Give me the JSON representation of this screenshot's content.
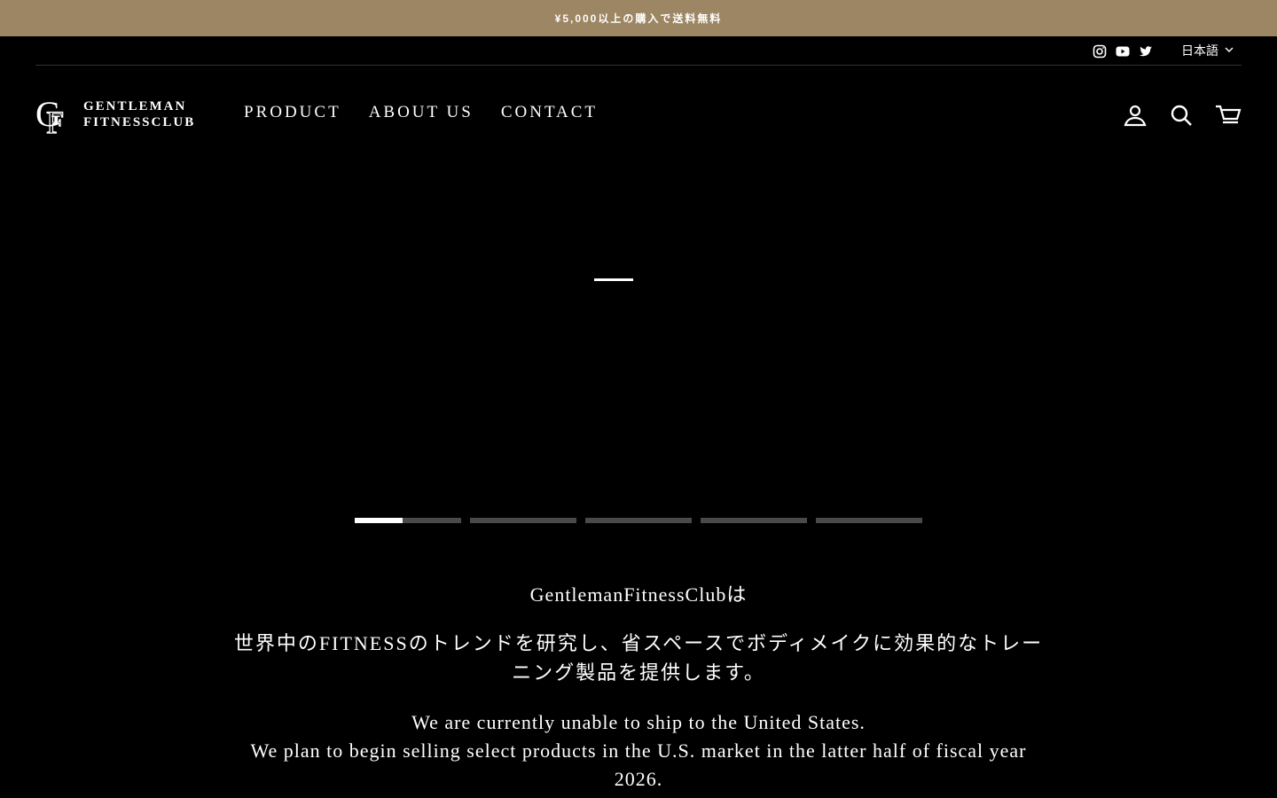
{
  "announcement": "¥5,000以上の購入で送料無料",
  "topbar": {
    "social": [
      {
        "name": "Instagram",
        "icon": "instagram-icon"
      },
      {
        "name": "YouTube",
        "icon": "youtube-icon"
      },
      {
        "name": "Twitter",
        "icon": "twitter-icon"
      }
    ],
    "language": "日本語"
  },
  "logo": {
    "line1": "GENTLEMAN",
    "line2": "FITNESSCLUB"
  },
  "nav": {
    "product": "PRODUCT",
    "about": "ABOUT US",
    "contact": "CONTACT"
  },
  "header_icons": [
    "user-icon",
    "search-icon",
    "cart-icon"
  ],
  "slideshow": {
    "count": 5,
    "active_index": 0,
    "active_progress": 0.45
  },
  "content": {
    "line1": "GentlemanFitnessClubは",
    "line2": "世界中のFITNESSのトレンドを研究し、省スペースでボディメイクに効果的なトレーニング製品を提供します。",
    "line3": "We are currently unable to ship to the United States.",
    "line4": "We plan to begin selling select products in the U.S. market in the latter half of fiscal year 2026."
  },
  "colors": {
    "announcement_bg": "#9c8663",
    "background": "#000000",
    "text": "#ffffff"
  }
}
